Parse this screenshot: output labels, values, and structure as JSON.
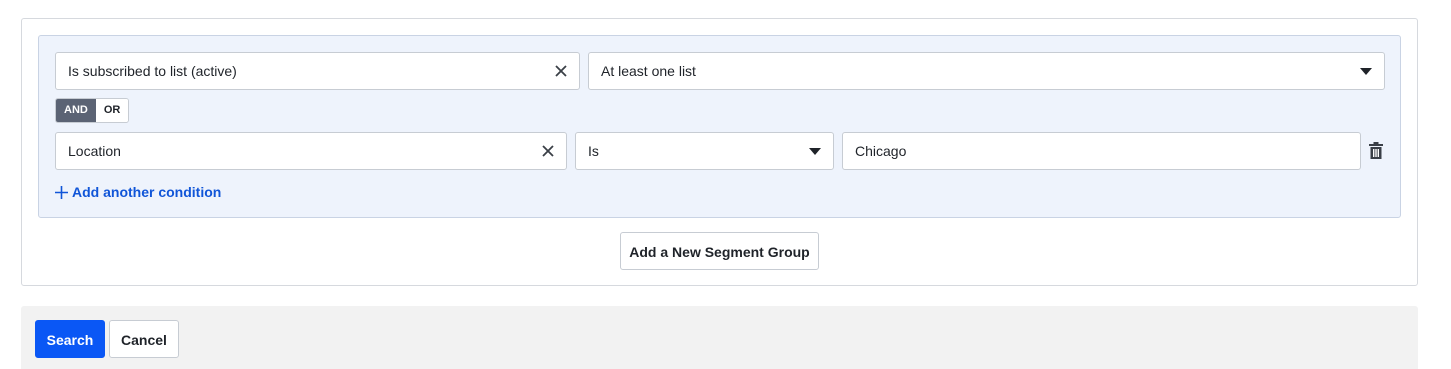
{
  "segment_group": {
    "condition_1": {
      "field": "Is subscribed to list (active)",
      "operator": "At least one list"
    },
    "conjunction": {
      "options": [
        "AND",
        "OR"
      ],
      "selected": "AND"
    },
    "condition_2": {
      "field": "Location",
      "operator": "Is",
      "value": "Chicago"
    },
    "add_condition_label": "Add another condition"
  },
  "add_group_label": "Add a New Segment Group",
  "footer": {
    "search_label": "Search",
    "cancel_label": "Cancel"
  },
  "colors": {
    "primary": "#0a57f5",
    "link": "#1055d8",
    "group_bg": "#eef3fc",
    "toggle_active": "#5b6374"
  },
  "icons": [
    "close-icon",
    "caret-down-icon",
    "trash-icon",
    "plus-icon"
  ]
}
